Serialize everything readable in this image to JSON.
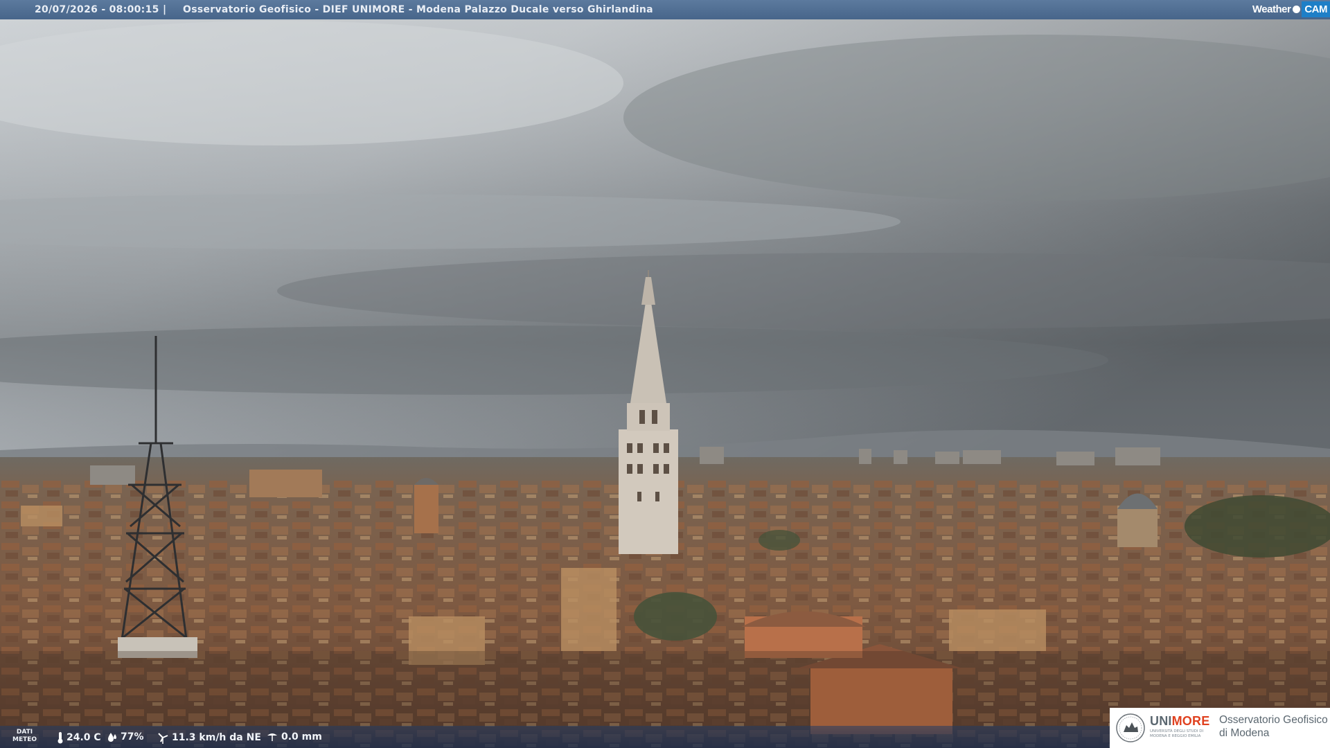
{
  "header": {
    "timestamp": "20/07/2026 - 08:00:15",
    "separator": "|",
    "title": "Osservatorio Geofisico - DIEF UNIMORE - Modena Palazzo Ducale verso Ghirlandina",
    "logo_text_left": "Weather",
    "logo_text_right": "CAM"
  },
  "weather": {
    "label_line1": "DATI",
    "label_line2": "METEO",
    "temperature": "24.0 C",
    "humidity": "77%",
    "wind": "11.3 km/h da NE",
    "rain": "0.0 mm",
    "icons": [
      "thermometer-icon",
      "humidity-drop-icon",
      "wind-turbine-icon",
      "rain-gauge-icon"
    ]
  },
  "branding": {
    "uni_prefix": "UNI",
    "uni_suffix": "MORE",
    "uni_subtitle": "UNIVERSITÀ DEGLI STUDI DI MODENA E REGGIO EMILIA",
    "observatory_line1": "Osservatorio Geofisico",
    "observatory_line2": "di Modena"
  },
  "colors": {
    "header_bar": "#4e6d93",
    "sky_light": "#c5cacd",
    "sky_dark": "#5e6366",
    "roofs": "#8a5a3e",
    "unimore_red": "#e0411f"
  }
}
